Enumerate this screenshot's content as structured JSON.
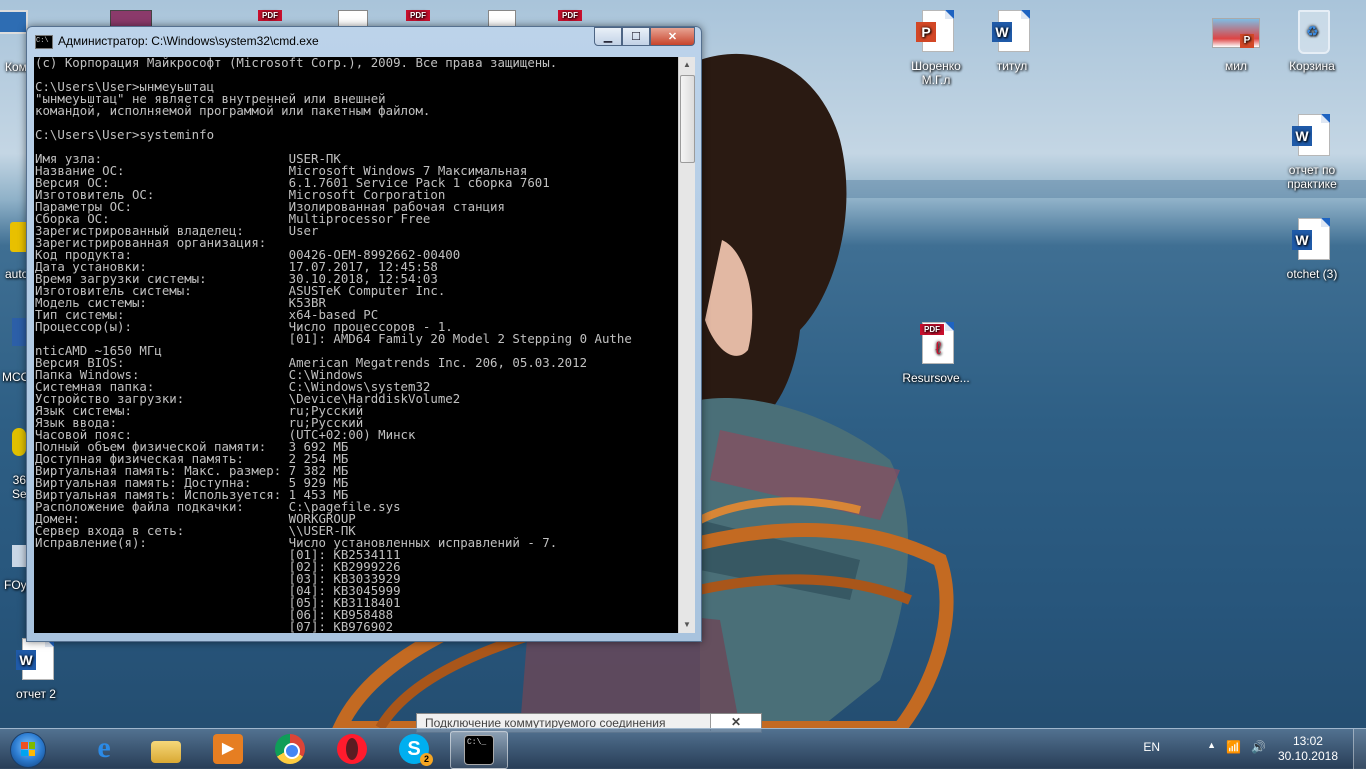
{
  "desktop": {
    "icons": [
      {
        "label": "Шоренко\nМ.Г.л",
        "type": "ppt"
      },
      {
        "label": "титул",
        "type": "word"
      },
      {
        "label": "мил",
        "type": "image"
      },
      {
        "label": "Корзина",
        "type": "recycle-bin"
      },
      {
        "label": "отчет по\nпрактике",
        "type": "word"
      },
      {
        "label": "otchet (3)",
        "type": "word"
      },
      {
        "label": "Resursove...",
        "type": "pdf"
      },
      {
        "label": "отчет 2",
        "type": "word"
      }
    ],
    "left_edge_labels": [
      "Ком",
      "auto",
      "MCO",
      "36\nSe",
      "FOy"
    ]
  },
  "cmd_window": {
    "title": "Администратор: C:\\Windows\\system32\\cmd.exe",
    "buttons": {
      "minimize": "▁",
      "maximize": "☐",
      "close": "✕"
    },
    "lines": [
      "(c) Корпорация Майкрософт (Microsoft Corp.), 2009. Все права защищены.",
      "",
      "C:\\Users\\User>ынмеуьштац",
      "\"ынмеуьштац\" не является внутренней или внешней",
      "командой, исполняемой программой или пакетным файлом.",
      "",
      "C:\\Users\\User>systeminfo",
      "",
      "Имя узла:                         USER-ПК",
      "Название ОС:                      Microsoft Windows 7 Максимальная",
      "Версия ОС:                        6.1.7601 Service Pack 1 сборка 7601",
      "Изготовитель ОС:                  Microsoft Corporation",
      "Параметры ОС:                     Изолированная рабочая станция",
      "Сборка ОС:                        Multiprocessor Free",
      "Зарегистрированный владелец:      User",
      "Зарегистрированная организация:",
      "Код продукта:                     00426-OEM-8992662-00400",
      "Дата установки:                   17.07.2017, 12:45:58",
      "Время загрузки системы:           30.10.2018, 12:54:03",
      "Изготовитель системы:             ASUSTeK Computer Inc.",
      "Модель системы:                   K53BR",
      "Тип системы:                      x64-based PC",
      "Процессор(ы):                     Число процессоров - 1.",
      "                                  [01]: AMD64 Family 20 Model 2 Stepping 0 Authe",
      "nticAMD ~1650 МГц",
      "Версия BIOS:                      American Megatrends Inc. 206, 05.03.2012",
      "Папка Windows:                    C:\\Windows",
      "Системная папка:                  C:\\Windows\\system32",
      "Устройство загрузки:              \\Device\\HarddiskVolume2",
      "Язык системы:                     ru;Русский",
      "Язык ввода:                       ru;Русский",
      "Часовой пояс:                     (UTC+02:00) Минск",
      "Полный объем физической памяти:   3 692 МБ",
      "Доступная физическая память:      2 254 МБ",
      "Виртуальная память: Макс. размер: 7 382 МБ",
      "Виртуальная память: Доступна:     5 929 МБ",
      "Виртуальная память: Используется: 1 453 МБ",
      "Расположение файла подкачки:      C:\\pagefile.sys",
      "Домен:                            WORKGROUP",
      "Сервер входа в сеть:              \\\\USER-ПК",
      "Исправление(я):                   Число установленных исправлений - 7.",
      "                                  [01]: KB2534111",
      "                                  [02]: KB2999226",
      "                                  [03]: KB3033929",
      "                                  [04]: KB3045999",
      "                                  [05]: KB3118401",
      "                                  [06]: KB958488",
      "                                  [07]: KB976902"
    ]
  },
  "notification": {
    "text": "Подключение коммутируемого соединения",
    "close": "✕"
  },
  "taskbar": {
    "pinned": [
      {
        "name": "internet-explorer",
        "glyph": "e"
      },
      {
        "name": "file-explorer",
        "glyph": ""
      },
      {
        "name": "media-player",
        "glyph": "▶"
      },
      {
        "name": "chrome",
        "glyph": ""
      },
      {
        "name": "opera",
        "glyph": "O"
      },
      {
        "name": "skype",
        "glyph": "S",
        "badge": "2"
      },
      {
        "name": "cmd",
        "glyph": "C:\\_"
      }
    ],
    "language": "EN",
    "tray_glyphs": [
      "▲",
      "📶",
      "🔊"
    ],
    "clock": {
      "time": "13:02",
      "date": "30.10.2018"
    }
  }
}
